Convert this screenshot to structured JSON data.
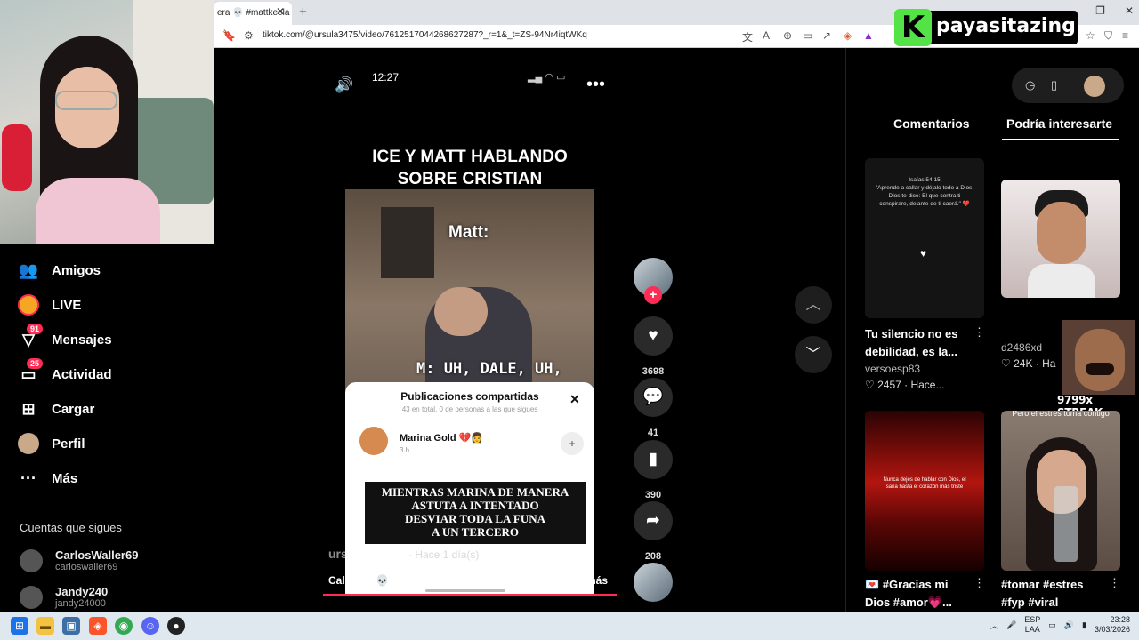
{
  "browser": {
    "tab_title": "era 💀 #mattkeela",
    "new_tab_glyph": "+",
    "url": "tiktok.com/@ursula3475/video/7612517044268627287?_r=1&_t=ZS-94Nr4iqtWKq"
  },
  "overlay": {
    "logo_letter": "K",
    "logo_text": "payasitazing",
    "streak_text": "9799x STREAK"
  },
  "sidebar": {
    "items": [
      {
        "label": "Amigos",
        "icon": "friends-icon"
      },
      {
        "label": "LIVE",
        "icon": "live-icon"
      },
      {
        "label": "Mensajes",
        "icon": "messages-icon",
        "badge": "91"
      },
      {
        "label": "Actividad",
        "icon": "activity-icon",
        "badge": "25"
      },
      {
        "label": "Cargar",
        "icon": "upload-icon"
      },
      {
        "label": "Perfil",
        "icon": "profile-avatar"
      },
      {
        "label": "Más",
        "icon": "more-icon"
      }
    ],
    "following_title": "Cuentas que sigues",
    "following": [
      {
        "name": "CarlosWaller69",
        "username": "carloswaller69"
      },
      {
        "name": "Jandy240",
        "username": "jandy24000"
      }
    ]
  },
  "video": {
    "phone_time": "12:27",
    "title": "ICE Y MATT HABLANDO SOBRE CRISTIAN",
    "overlay_label": "Matt:",
    "subtitle": "M: UH, DALE, UH,",
    "share_panel": {
      "title": "Publicaciones compartidas",
      "subtitle": "43 en total, 0 de personas a las que sigues",
      "user": "Marina Gold 💔👩",
      "time": "3 h",
      "image_text": "MIENTRAS MARINA DE MANERA\nASTUTA A INTENTADO\nDESVIAR TODA LA FUNA\nA UN TERCERO"
    },
    "author": "ursula3475",
    "posted": "· Hace 1 día(s)",
    "caption": "Calavera 💀 #mattkeelan #marinagold ...",
    "more": "más"
  },
  "actions": {
    "likes": "3698",
    "comments": "41",
    "saves": "390",
    "shares": "208"
  },
  "right_panel": {
    "tabs": [
      "Comentarios",
      "Podría interesarte"
    ],
    "cards": [
      {
        "thumb_text": "Isaías 54:15\n\"Aprende a callar y déjalo todo a Dios. Dios te dice: El que contra ti conspirare, delante de ti caerá.\" ❤️",
        "title": "Tu silencio no es debilidad, es la...",
        "user": "versoesp83",
        "likes": "2457",
        "ago": "Hace..."
      },
      {
        "title": "",
        "user": "d2486xd",
        "likes": "24K",
        "ago": "Ha"
      },
      {
        "thumb_text": "Nunca dejes de hablar con Dios, el sana hasta el corazón más triste",
        "title": "💌 #Gracias mi Dios #amor💗...",
        "user": "",
        "likes": "",
        "ago": ""
      },
      {
        "thumb_text": "Pero el estrés toma contigo",
        "title": "#tomar #estres #fyp #viral",
        "user": "",
        "likes": "",
        "ago": ""
      }
    ]
  },
  "taskbar": {
    "lang_top": "ESP",
    "lang_bottom": "LAA",
    "time": "23:28",
    "date": "3/03/2026"
  }
}
